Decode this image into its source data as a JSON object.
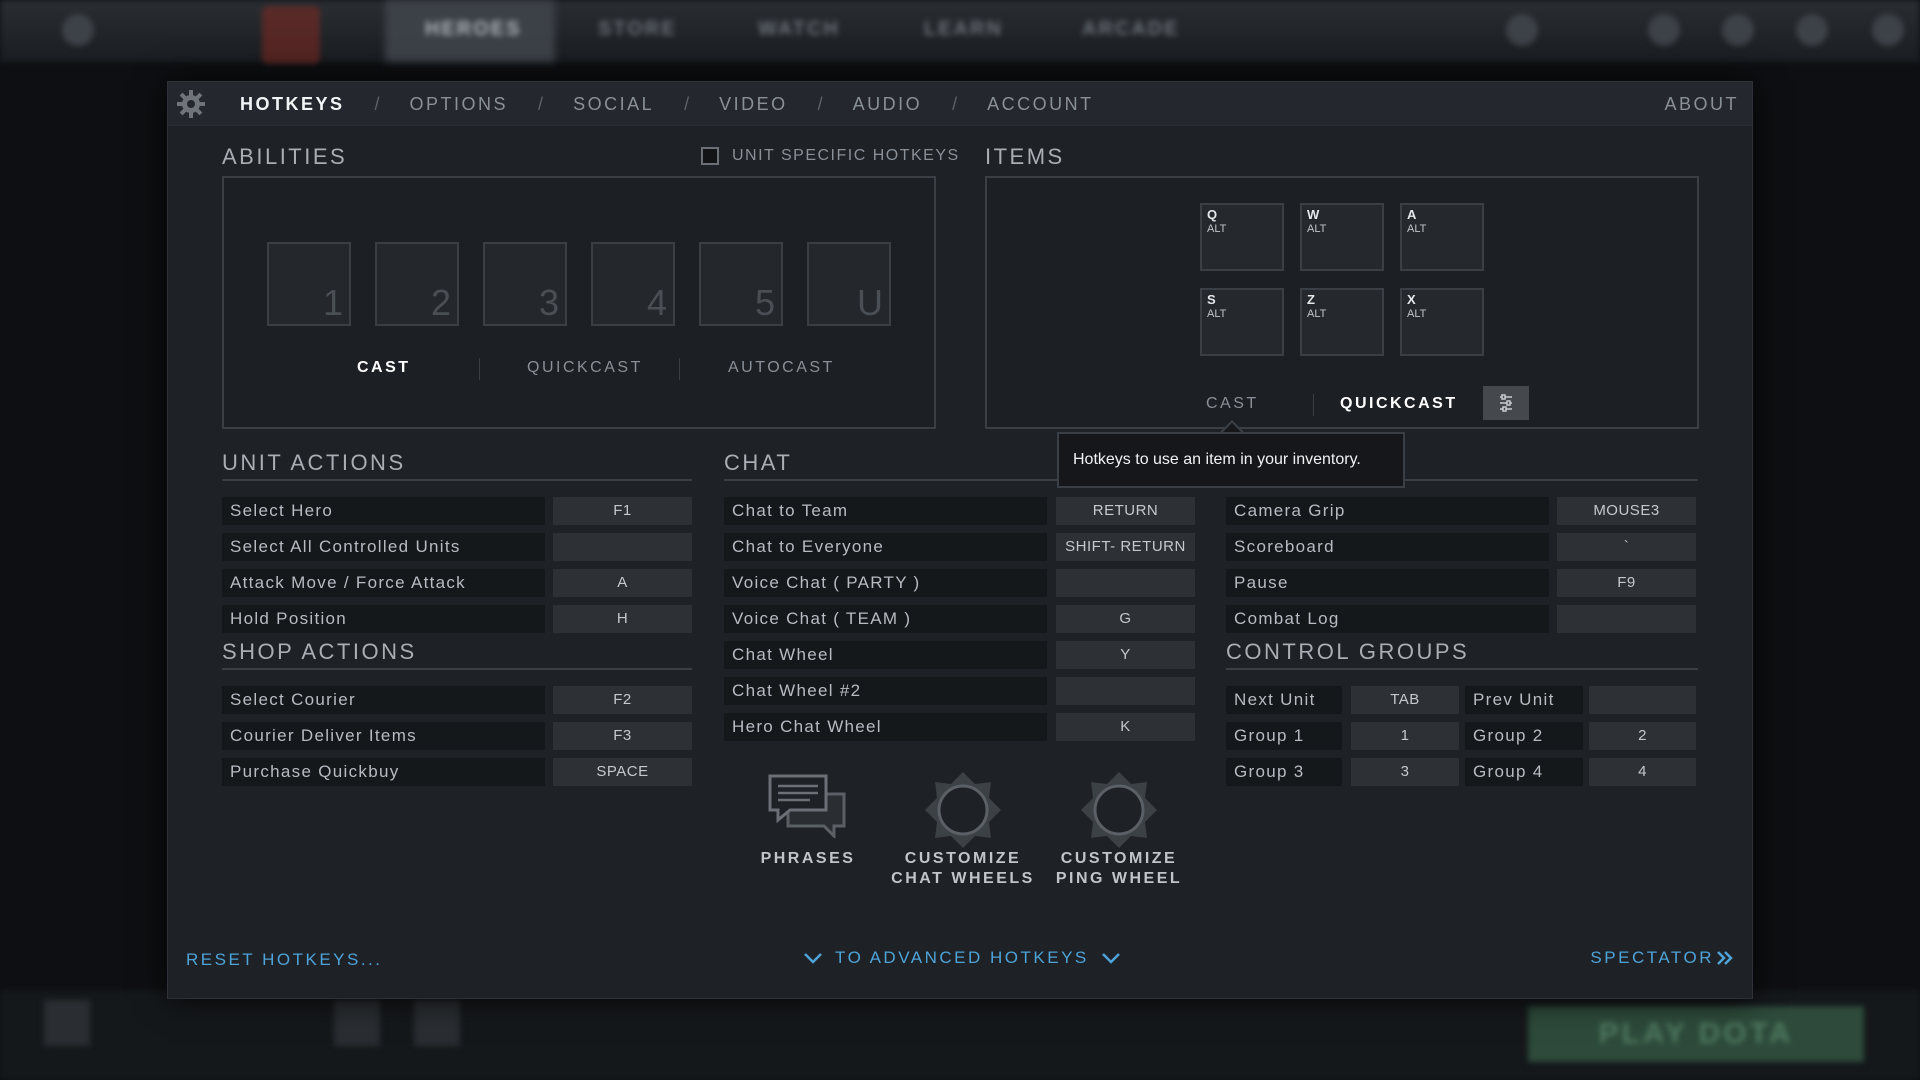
{
  "background": {
    "top_tabs": [
      "HEROES",
      "STORE",
      "WATCH",
      "LEARN",
      "ARCADE"
    ],
    "play_button": "PLAY DOTA"
  },
  "header": {
    "nav": [
      {
        "label": "HOTKEYS",
        "active": true
      },
      {
        "label": "OPTIONS",
        "active": false
      },
      {
        "label": "SOCIAL",
        "active": false
      },
      {
        "label": "VIDEO",
        "active": false
      },
      {
        "label": "AUDIO",
        "active": false
      },
      {
        "label": "ACCOUNT",
        "active": false
      }
    ],
    "separator": "/",
    "about": "ABOUT"
  },
  "abilities": {
    "title": "ABILITIES",
    "unit_specific_label": "UNIT SPECIFIC HOTKEYS",
    "unit_specific_checked": false,
    "slots": [
      "1",
      "2",
      "3",
      "4",
      "5",
      "U"
    ],
    "modes": [
      "CAST",
      "QUICKCAST",
      "AUTOCAST"
    ],
    "active_mode": "CAST"
  },
  "items": {
    "title": "ITEMS",
    "slots": [
      {
        "key": "Q",
        "mod": "ALT"
      },
      {
        "key": "W",
        "mod": "ALT"
      },
      {
        "key": "A",
        "mod": "ALT"
      },
      {
        "key": "S",
        "mod": "ALT"
      },
      {
        "key": "Z",
        "mod": "ALT"
      },
      {
        "key": "X",
        "mod": "ALT"
      }
    ],
    "modes": [
      "CAST",
      "QUICKCAST"
    ],
    "active_mode": "QUICKCAST",
    "tooltip": "Hotkeys to use an item in your inventory."
  },
  "unit_actions": {
    "title": "UNIT ACTIONS",
    "rows": [
      {
        "label": "Select Hero",
        "key": "F1"
      },
      {
        "label": "Select All Controlled Units",
        "key": ""
      },
      {
        "label": "Attack Move / Force Attack",
        "key": "A"
      },
      {
        "label": "Hold Position",
        "key": "H"
      }
    ]
  },
  "shop_actions": {
    "title": "SHOP ACTIONS",
    "rows": [
      {
        "label": "Select Courier",
        "key": "F2"
      },
      {
        "label": "Courier Deliver Items",
        "key": "F3"
      },
      {
        "label": "Purchase Quickbuy",
        "key": "SPACE"
      }
    ]
  },
  "chat": {
    "title": "CHAT",
    "rows": [
      {
        "label": "Chat to Team",
        "key": "RETURN"
      },
      {
        "label": "Chat to Everyone",
        "key": "SHIFT- RETURN"
      },
      {
        "label": "Voice Chat ( PARTY )",
        "key": ""
      },
      {
        "label": "Voice Chat ( TEAM )",
        "key": "G"
      },
      {
        "label": "Chat Wheel",
        "key": "Y"
      },
      {
        "label": "Chat Wheel #2",
        "key": ""
      },
      {
        "label": "Hero Chat Wheel",
        "key": "K"
      }
    ],
    "buttons": [
      {
        "line1": "PHRASES",
        "line2": "",
        "icon": "speech-bubbles-icon"
      },
      {
        "line1": "CUSTOMIZE",
        "line2": "CHAT WHEELS",
        "icon": "wheel-icon"
      },
      {
        "line1": "CUSTOMIZE",
        "line2": "PING WHEEL",
        "icon": "wheel-icon"
      }
    ]
  },
  "interface": {
    "rows": [
      {
        "label": "Camera Grip",
        "key": "MOUSE3"
      },
      {
        "label": "Scoreboard",
        "key": "`"
      },
      {
        "label": "Pause",
        "key": "F9"
      },
      {
        "label": "Combat Log",
        "key": ""
      }
    ]
  },
  "control_groups": {
    "title": "CONTROL GROUPS",
    "rows": [
      {
        "left_label": "Next Unit",
        "left_key": "TAB",
        "right_label": "Prev Unit",
        "right_key": ""
      },
      {
        "left_label": "Group 1",
        "left_key": "1",
        "right_label": "Group 2",
        "right_key": "2"
      },
      {
        "left_label": "Group 3",
        "left_key": "3",
        "right_label": "Group 4",
        "right_key": "4"
      }
    ]
  },
  "footer": {
    "reset": "RESET HOTKEYS...",
    "advanced": "TO ADVANCED HOTKEYS",
    "spectator": "SPECTATOR"
  },
  "colors": {
    "accent_link": "#4ea3d8",
    "panel_bg": "#1e2126"
  }
}
